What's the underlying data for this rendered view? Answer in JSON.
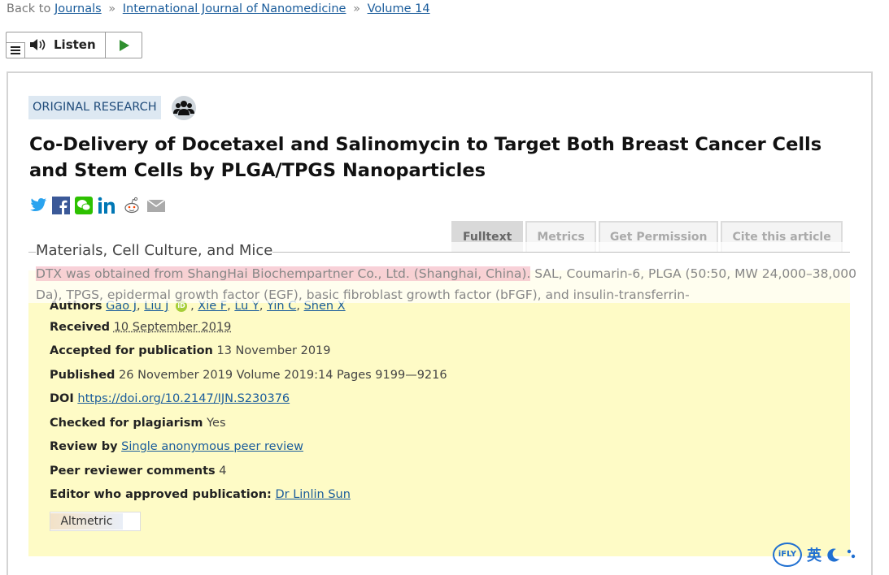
{
  "breadcrumb": {
    "prefix": "Back to",
    "items": [
      "Journals",
      "International Journal of Nanomedicine",
      "Volume 14"
    ],
    "separator": "»"
  },
  "listen": {
    "label": "Listen"
  },
  "article": {
    "type_badge": "ORIGINAL RESEARCH",
    "title": "Co-Delivery of Docetaxel and Salinomycin to Target Both Breast Cancer Cells and Stem Cells by PLGA/TPGS Nanoparticles"
  },
  "share_icons": [
    "twitter-icon",
    "facebook-icon",
    "wechat-icon",
    "linkedin-icon",
    "reddit-icon",
    "email-icon"
  ],
  "tabs": [
    "Fulltext",
    "Metrics",
    "Get Permission",
    "Cite this article"
  ],
  "sticky": {
    "section_title": "Materials, Cell Culture, and Mice",
    "highlighted": "DTX was obtained from ShangHai Biochempartner Co., Ltd. (Shanghai, China).",
    "rest": " SAL, Coumarin-6, PLGA (50:50, MW 24,000–38,000 Da), TPGS, epidermal growth factor (EGF), basic fibroblast growth factor (bFGF), and insulin-transferrin-"
  },
  "details": {
    "authors_label": "Authors",
    "authors": [
      "Gao J",
      "Liu J",
      "Xie F",
      "Lu Y",
      "Yin C",
      "Shen X"
    ],
    "received_label": "Received",
    "received": "10 September 2019",
    "accepted_label": "Accepted for publication",
    "accepted": "13 November 2019",
    "published_label": "Published",
    "published": "26 November 2019 Volume 2019:14 Pages 9199—9216",
    "doi_label": "DOI",
    "doi": "https://doi.org/10.2147/IJN.S230376",
    "plagiarism_label": "Checked for plagiarism",
    "plagiarism": "Yes",
    "review_label": "Review by",
    "review": "Single anonymous peer review",
    "comments_label": "Peer reviewer comments",
    "comments": "4",
    "editor_label": "Editor who approved publication:",
    "editor": "Dr Linlin Sun",
    "altmetric": "Altmetric"
  },
  "ifly": {
    "logo": "iFLY",
    "lang": "英"
  }
}
